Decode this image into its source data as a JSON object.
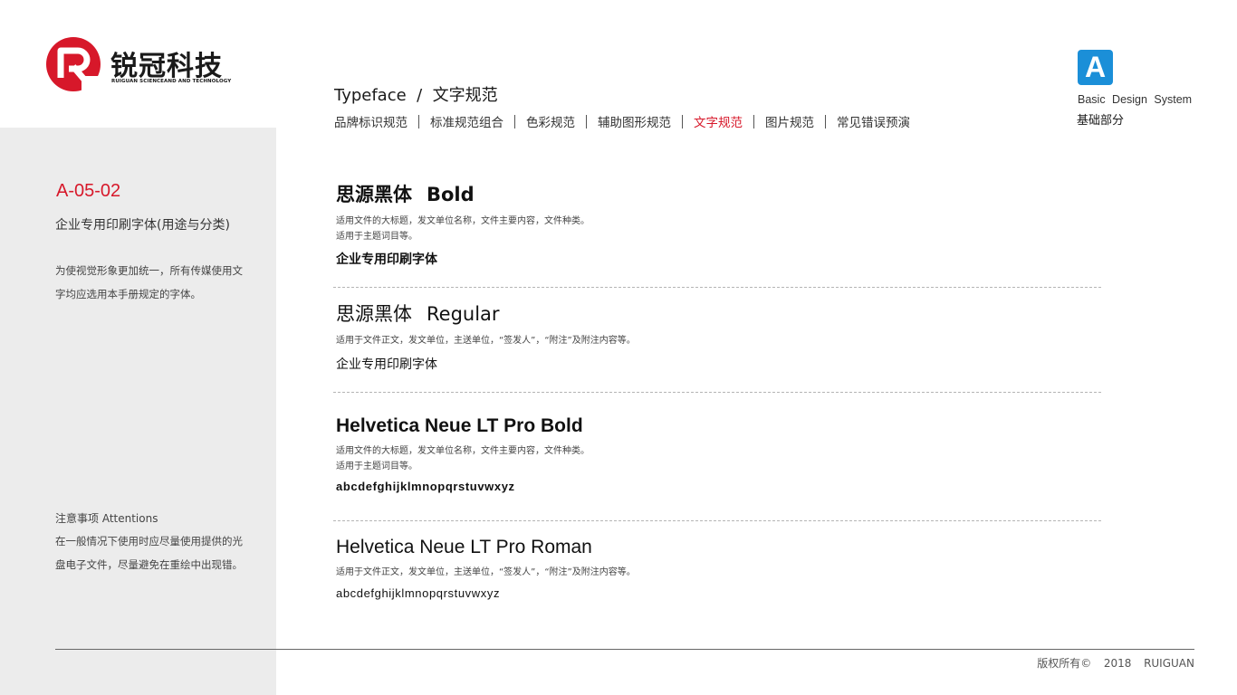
{
  "brand": {
    "name_cn": "锐冠科技",
    "name_en": "RUIGUAN SCIENCEAND AND TECHNOLOGY",
    "color_red": "#d7182a",
    "color_dark": "#1a1a1a"
  },
  "sidebar": {
    "code": "A-05-02",
    "title": "企业专用印刷字体(用途与分类)",
    "description": "为使视觉形象更加统一，所有传媒使用文字均应选用本手册规定的字体。",
    "attention_title": "注意事项 Attentions",
    "attention_body": "在一般情况下使用时应尽量使用提供的光盘电子文件，尽量避免在重绘中出现错。"
  },
  "header": {
    "heading": "Typeface  /  文字规范",
    "nav": [
      {
        "label": "品牌标识规范",
        "active": false
      },
      {
        "label": "标准规范组合",
        "active": false
      },
      {
        "label": "色彩规范",
        "active": false
      },
      {
        "label": "辅助图形规范",
        "active": false
      },
      {
        "label": "文字规范",
        "active": true
      },
      {
        "label": "图片规范",
        "active": false
      },
      {
        "label": "常见错误预演",
        "active": false
      }
    ]
  },
  "badge": {
    "letter": "A",
    "title_en": "Basic Design System",
    "title_cn": "基础部分",
    "color": "#1b8fd8"
  },
  "fonts": [
    {
      "name_cn": "思源黑体",
      "name_latin": "Bold",
      "desc_line1": "适用文件的大标题，发文单位名称，文件主要内容，文件种类。",
      "desc_line2": "适用于主题词目等。",
      "sample": "企业专用印刷字体"
    },
    {
      "name_cn": "思源黑体",
      "name_latin": "Regular",
      "desc_line1": "适用于文件正文，发文单位，主送单位，“签发人”，“附注”及附注内容等。",
      "sample": "企业专用印刷字体"
    },
    {
      "name": "Helvetica Neue LT Pro Bold",
      "desc_line1": "适用文件的大标题，发文单位名称，文件主要内容，文件种类。",
      "desc_line2": "适用于主题词目等。",
      "sample": "abcdefghijklmnopqrstuvwxyz"
    },
    {
      "name": "Helvetica Neue LT Pro Roman",
      "desc_line1": "适用于文件正文，发文单位，主送单位，“签发人”，“附注”及附注内容等。",
      "sample": "abcdefghijklmnopqrstuvwxyz"
    }
  ],
  "footer": {
    "copyright": "版权所有©  2018  RUIGUAN"
  }
}
